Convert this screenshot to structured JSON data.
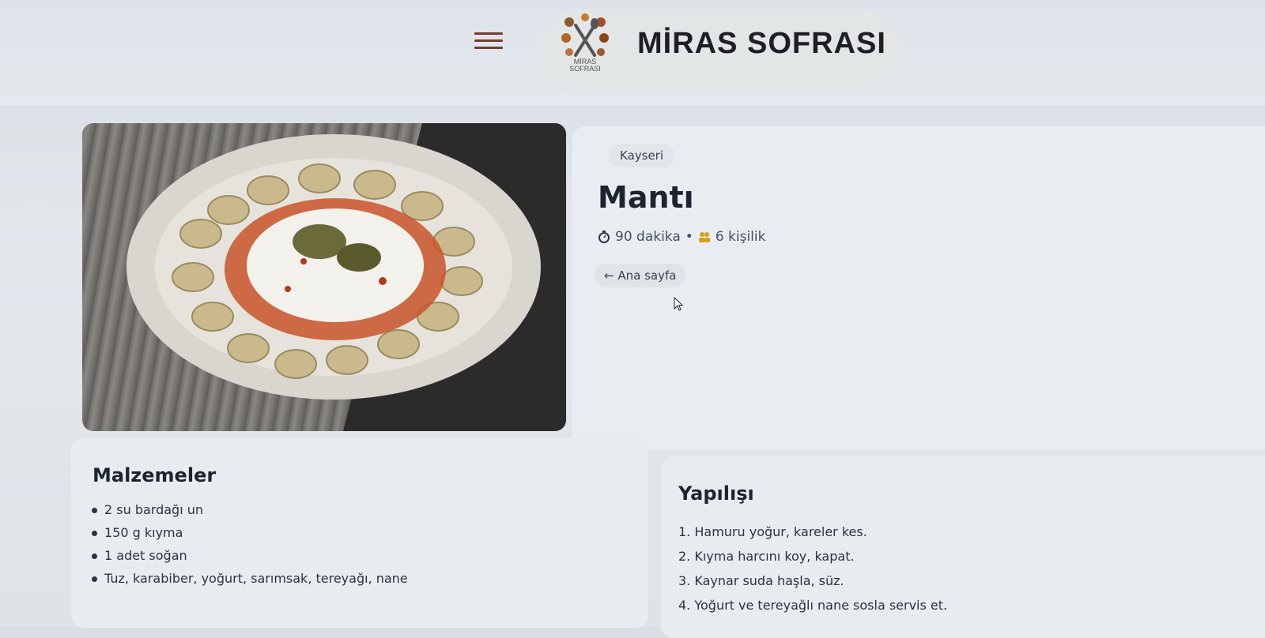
{
  "header": {
    "logo_text_line1": "MİRAS",
    "logo_text_line2": "SOFRASI",
    "title": "MİRAS SOFRASI"
  },
  "recipe": {
    "region_tag": "Kayseri",
    "title": "Mantı",
    "duration": "90 dakika",
    "separator": "•",
    "servings": "6 kişilik",
    "back_label": "← Ana sayfa"
  },
  "ingredients": {
    "title": "Malzemeler",
    "items": [
      "2 su bardağı un",
      "150 g kıyma",
      "1 adet soğan",
      "Tuz, karabiber, yoğurt, sarımsak, tereyağı, nane"
    ]
  },
  "steps": {
    "title": "Yapılışı",
    "items": [
      "1. Hamuru yoğur, kareler kes.",
      "2. Kıyma harcını koy, kapat.",
      "3. Kaynar suda haşla, süz.",
      "4. Yoğurt ve tereyağlı nane sosla servis et."
    ]
  },
  "colors": {
    "menu_icon": "#7a3a2e",
    "servings_icon": "#d4a017"
  }
}
